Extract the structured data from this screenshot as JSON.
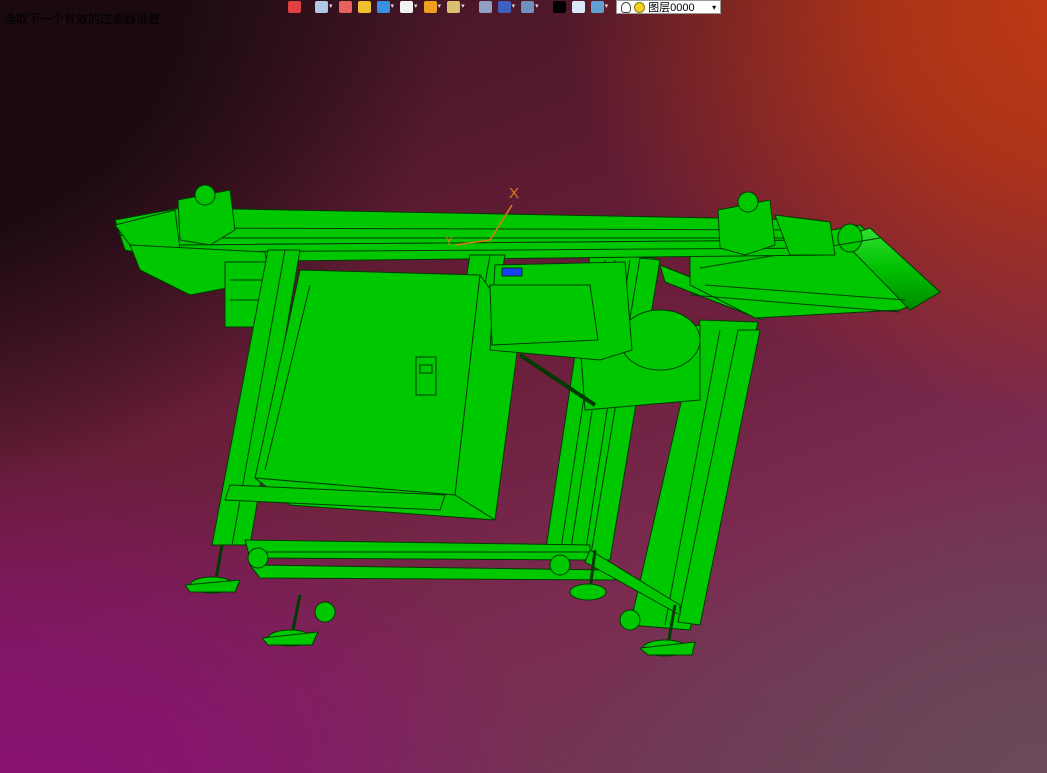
{
  "status": {
    "message": "选取下一个有效的过滤器设置"
  },
  "toolbar": {
    "buttons": [
      {
        "icon": "exit-icon",
        "color": "#e04040",
        "dropdown": false
      },
      {
        "icon": "display-mode-icon",
        "color": "#b0c8e8",
        "dropdown": true
      },
      {
        "icon": "pencil-icon",
        "color": "#e86060",
        "dropdown": false
      },
      {
        "icon": "layer-stack-icon",
        "color": "#f0c030",
        "dropdown": false
      },
      {
        "icon": "cube-blue-icon",
        "color": "#3a90e0",
        "dropdown": true
      },
      {
        "icon": "cube-white-icon",
        "color": "#f0f0f0",
        "dropdown": true
      },
      {
        "icon": "color-wheel-icon",
        "color": "#f0a020",
        "dropdown": true
      },
      {
        "icon": "zoom-icon",
        "color": "#d8c070",
        "dropdown": true
      },
      {
        "icon": "rotate-icon",
        "color": "#90a0c0",
        "dropdown": false
      },
      {
        "icon": "frame-icon",
        "color": "#4060c0",
        "dropdown": true
      },
      {
        "icon": "monitor-icon",
        "color": "#7090c0",
        "dropdown": true
      },
      {
        "icon": "black-rect-icon",
        "color": "#000000",
        "dropdown": false
      },
      {
        "icon": "white-page-icon",
        "color": "#d8e8f8",
        "dropdown": false
      },
      {
        "icon": "layers-icon",
        "color": "#60a0d0",
        "dropdown": true
      }
    ],
    "layer_select": {
      "value": "图层0000"
    }
  },
  "viewport": {
    "axis": {
      "x_label": "X",
      "y_label": "Y"
    },
    "model_color": "#00c800",
    "edge_color": "#003a00",
    "axis_color": "#e07818"
  }
}
